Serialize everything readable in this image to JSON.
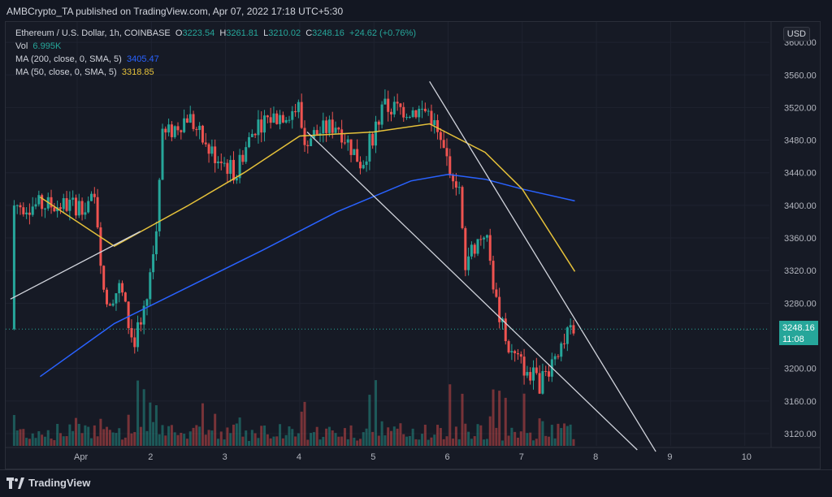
{
  "header": {
    "published_text": "AMBCrypto_TA published on TradingView.com, Apr 07, 2022 17:18 UTC+5:30"
  },
  "legend": {
    "symbol": "Ethereum / U.S. Dollar, 1h, COINBASE",
    "o_label": "O",
    "o_value": "3223.54",
    "h_label": "H",
    "h_value": "3261.81",
    "l_label": "L",
    "l_value": "3210.02",
    "c_label": "C",
    "c_value": "3248.16",
    "change": "+24.62 (+0.76%)",
    "vol_label": "Vol",
    "vol_value": "6.995K",
    "ma200_label": "MA (200, close, 0, SMA, 5)",
    "ma200_value": "3405.47",
    "ma50_label": "MA (50, close, 0, SMA, 5)",
    "ma50_value": "3318.85"
  },
  "currency_button": "USD",
  "last_price": {
    "price": "3248.16",
    "countdown": "11:08"
  },
  "colors": {
    "up": "#26a69a",
    "down": "#ef5350",
    "ma200": "#2962ff",
    "ma50": "#e5c13a",
    "trendline": "#d1d4dc"
  },
  "footer": {
    "brand": "TradingView"
  },
  "chart_data": {
    "type": "candlestick",
    "price_axis": {
      "ticks": [
        "3600.00",
        "3560.00",
        "3520.00",
        "3480.00",
        "3440.00",
        "3400.00",
        "3360.00",
        "3320.00",
        "3280.00",
        "3200.00",
        "3160.00",
        "3120.00"
      ],
      "range": [
        3105,
        3625
      ]
    },
    "time_axis": {
      "ticks": [
        "Apr",
        "2",
        "3",
        "4",
        "5",
        "6",
        "7",
        "8",
        "9",
        "10"
      ]
    },
    "close_path": [
      [
        "Apr 1 00:00",
        3400
      ],
      [
        "Apr 1 06:00",
        3405
      ],
      [
        "Apr 1 09:00",
        3280
      ],
      [
        "Apr 1 14:00",
        3300
      ],
      [
        "Apr 1 18:00",
        3230
      ],
      [
        "Apr 1 22:00",
        3270
      ],
      [
        "Apr 2 02:00",
        3380
      ],
      [
        "Apr 2 03:00",
        3480
      ],
      [
        "Apr 2 12:00",
        3510
      ],
      [
        "Apr 2 18:00",
        3470
      ],
      [
        "Apr 3 03:00",
        3440
      ],
      [
        "Apr 3 10:00",
        3500
      ],
      [
        "Apr 4 00:00",
        3520
      ],
      [
        "Apr 4 01:00",
        3480
      ],
      [
        "Apr 4 12:00",
        3500
      ],
      [
        "Apr 4 20:00",
        3450
      ],
      [
        "Apr 5 03:00",
        3520
      ],
      [
        "Apr 5 18:00",
        3515
      ],
      [
        "Apr 5 22:00",
        3470
      ],
      [
        "Apr 6 04:00",
        3420
      ],
      [
        "Apr 6 05:00",
        3330
      ],
      [
        "Apr 6 12:00",
        3370
      ],
      [
        "Apr 6 16:00",
        3270
      ],
      [
        "Apr 6 20:00",
        3220
      ],
      [
        "Apr 7 06:00",
        3180
      ],
      [
        "Apr 7 12:00",
        3230
      ],
      [
        "Apr 7 17:00",
        3248.16
      ]
    ],
    "ma200_path": [
      [
        "Mar 31 12:00",
        3190
      ],
      [
        "Apr 1 12:00",
        3255
      ],
      [
        "Apr 2 12:00",
        3300
      ],
      [
        "Apr 3 12:00",
        3345
      ],
      [
        "Apr 4 12:00",
        3392
      ],
      [
        "Apr 5 12:00",
        3430
      ],
      [
        "Apr 6 00:00",
        3438
      ],
      [
        "Apr 6 12:00",
        3432
      ],
      [
        "Apr 7 00:00",
        3420
      ],
      [
        "Apr 7 17:00",
        3405.47
      ]
    ],
    "ma50_path": [
      [
        "Mar 31 12:00",
        3410
      ],
      [
        "Apr 1 12:00",
        3350
      ],
      [
        "Apr 2 12:00",
        3400
      ],
      [
        "Apr 3 06:00",
        3440
      ],
      [
        "Apr 4 00:00",
        3485
      ],
      [
        "Apr 5 00:00",
        3490
      ],
      [
        "Apr 5 18:00",
        3500
      ],
      [
        "Apr 6 12:00",
        3465
      ],
      [
        "Apr 7 00:00",
        3420
      ],
      [
        "Apr 7 17:00",
        3318.85
      ]
    ]
  }
}
